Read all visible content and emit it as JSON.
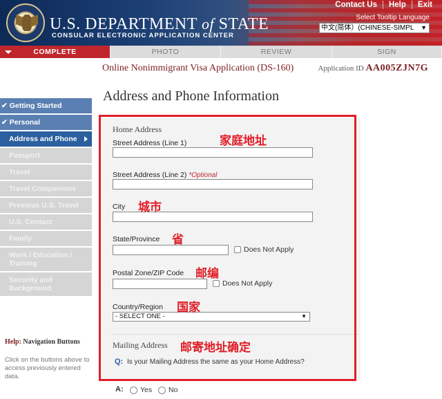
{
  "header": {
    "brand_main": "U.S. DEPARTMENT",
    "brand_of": "of",
    "brand_state": "STATE",
    "brand_sub": "CONSULAR ELECTRONIC APPLICATION CENTER",
    "links": [
      "Contact Us",
      "Help",
      "Exit"
    ],
    "tooltip_label": "Select Tooltip Language",
    "language_selected": "中文(简体）(CHINESE-SIMPL"
  },
  "tabs": [
    {
      "label": "COMPLETE",
      "state": "active"
    },
    {
      "label": "PHOTO",
      "state": "inactive"
    },
    {
      "label": "REVIEW",
      "state": "inactive"
    },
    {
      "label": "SIGN",
      "state": "inactive"
    }
  ],
  "form_title": "Online Nonimmigrant Visa Application (DS-160)",
  "application_id_label": "Application ID",
  "application_id": "AA005ZJN7G",
  "page_title": "Address and Phone Information",
  "sidebar": {
    "items": [
      {
        "label": "✔ Getting Started",
        "state": "done"
      },
      {
        "label": "✔ Personal",
        "state": "done"
      },
      {
        "label": "Address and Phone",
        "state": "current"
      },
      {
        "label": "Passport",
        "state": "disabled"
      },
      {
        "label": "Travel",
        "state": "disabled"
      },
      {
        "label": "Travel Companions",
        "state": "disabled"
      },
      {
        "label": "Previous U.S. Travel",
        "state": "disabled"
      },
      {
        "label": "U.S. Contact",
        "state": "disabled"
      },
      {
        "label": "Family",
        "state": "disabled"
      },
      {
        "label": "Work / Education / Training",
        "state": "disabled"
      },
      {
        "label": "Security and Background",
        "state": "disabled"
      }
    ],
    "help_prefix": "Help:",
    "help_title": "Navigation Buttons",
    "help_text": "Click on the buttons above to access previously entered data."
  },
  "form": {
    "home_address_label": "Home Address",
    "street1_label": "Street Address (Line 1)",
    "street1_value": "",
    "street2_label": "Street Address (Line 2)",
    "street2_optional": "*Optional",
    "street2_value": "",
    "city_label": "City",
    "city_value": "",
    "state_label": "State/Province",
    "state_value": "",
    "state_dna_label": "Does Not Apply",
    "postal_label": "Postal Zone/ZIP Code",
    "postal_value": "",
    "postal_dna_label": "Does Not Apply",
    "country_label": "Country/Region",
    "country_selected": "- SELECT ONE -",
    "mailing_address_label": "Mailing Address",
    "question_mark": "Q:",
    "question_text": "Is your Mailing Address the same as your Home Address?",
    "answer_mark": "A:",
    "yes_label": "Yes",
    "no_label": "No"
  },
  "annotations": {
    "home_address": "家庭地址",
    "city": "城市",
    "province": "省",
    "postal": "邮编",
    "country": "国家",
    "mailing": "邮寄地址确定"
  },
  "colors": {
    "accent_red": "#c0272d",
    "annotation_red": "#e11d26",
    "nav_blue": "#2b5f9e",
    "nav_done": "#5a7fb2"
  }
}
